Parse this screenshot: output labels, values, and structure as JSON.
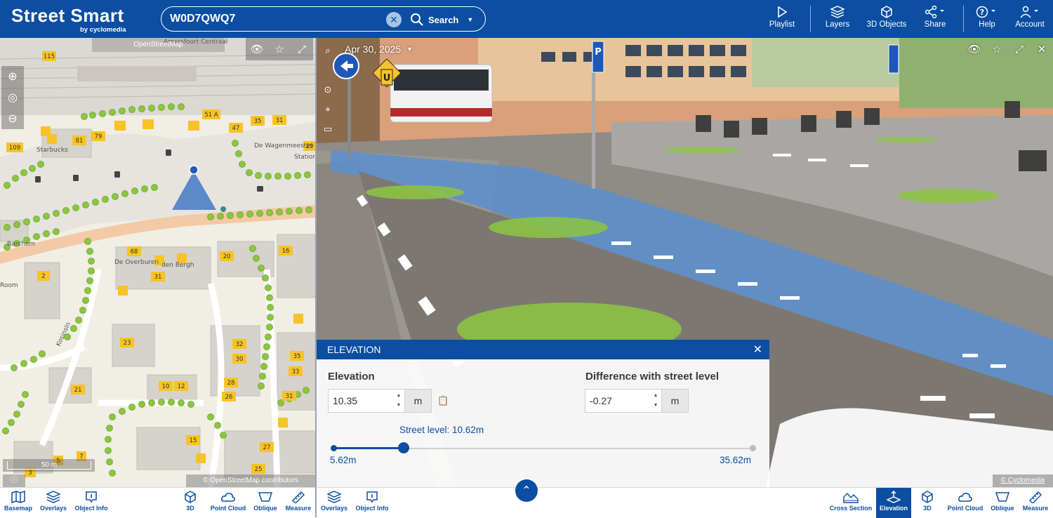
{
  "app": {
    "title": "Street Smart",
    "subtitle": "by cyclomedia"
  },
  "search": {
    "value": "W0D7QWQ7",
    "button_label": "Search"
  },
  "toolbar": [
    {
      "label": "Playlist",
      "icon": "play-icon"
    },
    {
      "label": "Layers",
      "icon": "layers-icon"
    },
    {
      "label": "3D Objects",
      "icon": "cube-icon"
    },
    {
      "label": "Share",
      "icon": "share-icon"
    },
    {
      "label": "Help",
      "icon": "help-icon"
    },
    {
      "label": "Account",
      "icon": "user-icon"
    }
  ],
  "map": {
    "source_label": "OpenStreetMap",
    "scale_label": "50 m",
    "attribution": "© OpenStreetMap contributors",
    "labels": [
      "Amersfoort Centraal",
      "Starbucks",
      "De Wagenmeester",
      "Station",
      "De Overburen",
      "den Bergh",
      "Kosinsln",
      "Barchem",
      "Room"
    ],
    "house_numbers": [
      "115",
      "51 A",
      "35",
      "31",
      "47",
      "79",
      "81",
      "109",
      "29",
      "68",
      "16",
      "20",
      "2",
      "31",
      "23",
      "32",
      "30",
      "35",
      "33",
      "21",
      "10",
      "12",
      "28",
      "26",
      "31",
      "15",
      "27",
      "5",
      "7",
      "25",
      "3"
    ]
  },
  "pano": {
    "date": "Apr 30, 2025",
    "attribution": "© Cyclomedia"
  },
  "elevation_panel": {
    "title": "ELEVATION",
    "elevation_label": "Elevation",
    "elevation_value": "10.35",
    "elevation_unit": "m",
    "difference_label": "Difference with street level",
    "difference_value": "-0.27",
    "difference_unit": "m",
    "street_level": "Street level: 10.62m",
    "range_min": "5.62m",
    "range_max": "35.62m",
    "slider_position": 0.167
  },
  "left_bottombar": [
    {
      "label": "Basemap",
      "icon": "map-icon"
    },
    {
      "label": "Overlays",
      "icon": "layers-icon"
    },
    {
      "label": "Object Info",
      "icon": "info-icon"
    },
    {
      "label": "3D",
      "icon": "cube-icon"
    },
    {
      "label": "Point Cloud",
      "icon": "cloud-icon"
    },
    {
      "label": "Oblique",
      "icon": "oblique-icon"
    },
    {
      "label": "Measure",
      "icon": "ruler-icon"
    }
  ],
  "right_bottombar": [
    {
      "label": "Overlays",
      "icon": "layers-icon"
    },
    {
      "label": "Object Info",
      "icon": "info-icon"
    },
    {
      "label": "Cross Section",
      "icon": "cross-section-icon"
    },
    {
      "label": "Elevation",
      "icon": "elevation-icon",
      "active": true
    },
    {
      "label": "3D",
      "icon": "cube-icon"
    },
    {
      "label": "Point Cloud",
      "icon": "cloud-icon"
    },
    {
      "label": "Oblique",
      "icon": "oblique-icon"
    },
    {
      "label": "Measure",
      "icon": "ruler-icon"
    }
  ],
  "colors": {
    "brand": "#0b4ea2",
    "tree": "#8cc63f",
    "house_number": "#f7c325",
    "bike_lane": "#5b8fce"
  }
}
